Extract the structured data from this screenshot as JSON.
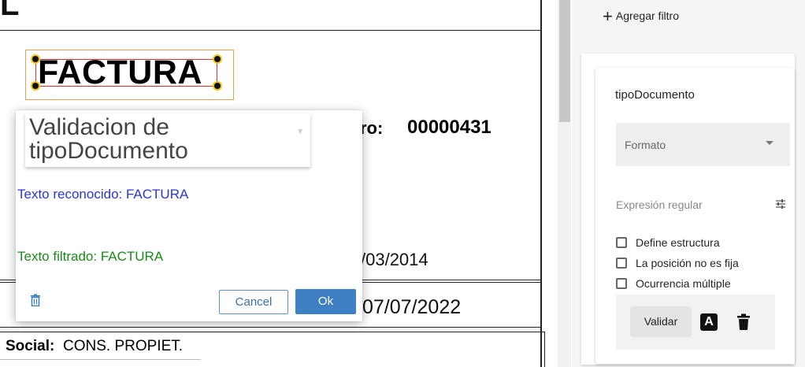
{
  "document": {
    "top_letter": "L",
    "factura_text": "FACTURA",
    "nro_label": "ro:",
    "nro_value": "00000431",
    "date1": "/03/2014",
    "date2": "07/07/2022",
    "social_label": "Social:",
    "social_value": "CONS. PROPIET."
  },
  "popup": {
    "title": "Validacion de tipoDocumento",
    "recognized_text": "Texto reconocido: FACTURA",
    "filtered_text": "Texto filtrado: FACTURA",
    "cancel_label": "Cancel",
    "ok_label": "Ok"
  },
  "panel": {
    "add_filter_label": "Agregar filtro",
    "field_name": "tipoDocumento",
    "format_placeholder": "Formato",
    "regex_placeholder": "Expresión regular",
    "checkboxes": [
      {
        "label": "Define estructura",
        "checked": false
      },
      {
        "label": "La posición no es fija",
        "checked": false
      },
      {
        "label": "Ocurrencia múltiple",
        "checked": false
      }
    ],
    "validate_label": "Validar",
    "font_icon_letter": "A"
  },
  "colors": {
    "recognized": "#2a35d6",
    "filtered": "#1a8a1a",
    "primary_button": "#3f7fc4",
    "selection_outer": "#e8a04a",
    "selection_inner": "#e03030"
  }
}
